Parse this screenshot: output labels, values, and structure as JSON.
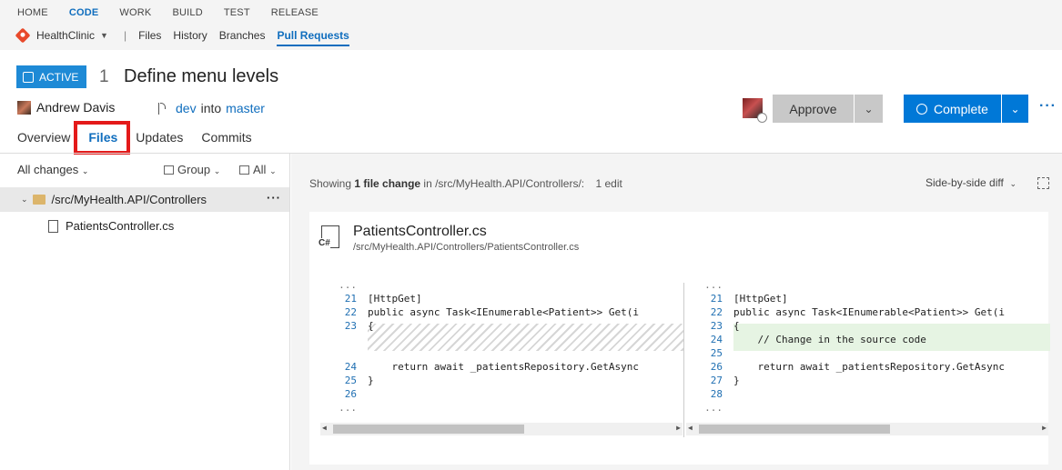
{
  "hubs": [
    "HOME",
    "CODE",
    "WORK",
    "BUILD",
    "TEST",
    "RELEASE"
  ],
  "active_hub": "CODE",
  "subnav": {
    "repo": "HealthClinic",
    "separator": "|",
    "links": [
      "Files",
      "History",
      "Branches",
      "Pull Requests"
    ],
    "active": "Pull Requests"
  },
  "pr": {
    "status": "ACTIVE",
    "number": "1",
    "title": "Define menu levels",
    "author": "Andrew Davis",
    "source_branch": "dev",
    "into": "into",
    "target_branch": "master",
    "approve_label": "Approve",
    "complete_label": "Complete",
    "more": "···"
  },
  "tabs": [
    "Overview",
    "Files",
    "Updates",
    "Commits"
  ],
  "active_tab": "Files",
  "left_panel": {
    "all_changes": "All changes",
    "group": "Group",
    "all": "All",
    "folder": "/src/MyHealth.API/Controllers",
    "folder_more": "···",
    "file": "PatientsController.cs"
  },
  "summary": {
    "prefix": "Showing",
    "count": "1 file change",
    "in": "in /src/MyHealth.API/Controllers/:",
    "edit": "1 edit",
    "view_mode": "Side-by-side diff"
  },
  "file_card": {
    "icon_label": "C#",
    "name": "PatientsController.cs",
    "path": "/src/MyHealth.API/Controllers/PatientsController.cs"
  },
  "diff_left": [
    {
      "ln": "...",
      "code": ""
    },
    {
      "ln": "21",
      "code": "[HttpGet]"
    },
    {
      "ln": "22",
      "code": "public async Task<IEnumerable<Patient>> Get(i"
    },
    {
      "ln": "23",
      "code": "{"
    },
    {
      "ln": "",
      "code": ""
    },
    {
      "ln": "",
      "code": ""
    },
    {
      "ln": "24",
      "code": "    return await _patientsRepository.GetAsync"
    },
    {
      "ln": "25",
      "code": "}"
    },
    {
      "ln": "26",
      "code": ""
    },
    {
      "ln": "...",
      "code": ""
    }
  ],
  "diff_right": [
    {
      "ln": "...",
      "code": ""
    },
    {
      "ln": "21",
      "code": "[HttpGet]"
    },
    {
      "ln": "22",
      "code": "public async Task<IEnumerable<Patient>> Get(i"
    },
    {
      "ln": "23",
      "code": "{"
    },
    {
      "ln": "24",
      "code": "    // Change in the source code"
    },
    {
      "ln": "25",
      "code": ""
    },
    {
      "ln": "26",
      "code": "    return await _patientsRepository.GetAsync"
    },
    {
      "ln": "27",
      "code": "}"
    },
    {
      "ln": "28",
      "code": ""
    },
    {
      "ln": "...",
      "code": ""
    }
  ],
  "colors": {
    "accent": "#0078d7",
    "badge": "#1e8ad6",
    "highlight_box": "#e41a1a",
    "added": "#e6f4e3"
  }
}
